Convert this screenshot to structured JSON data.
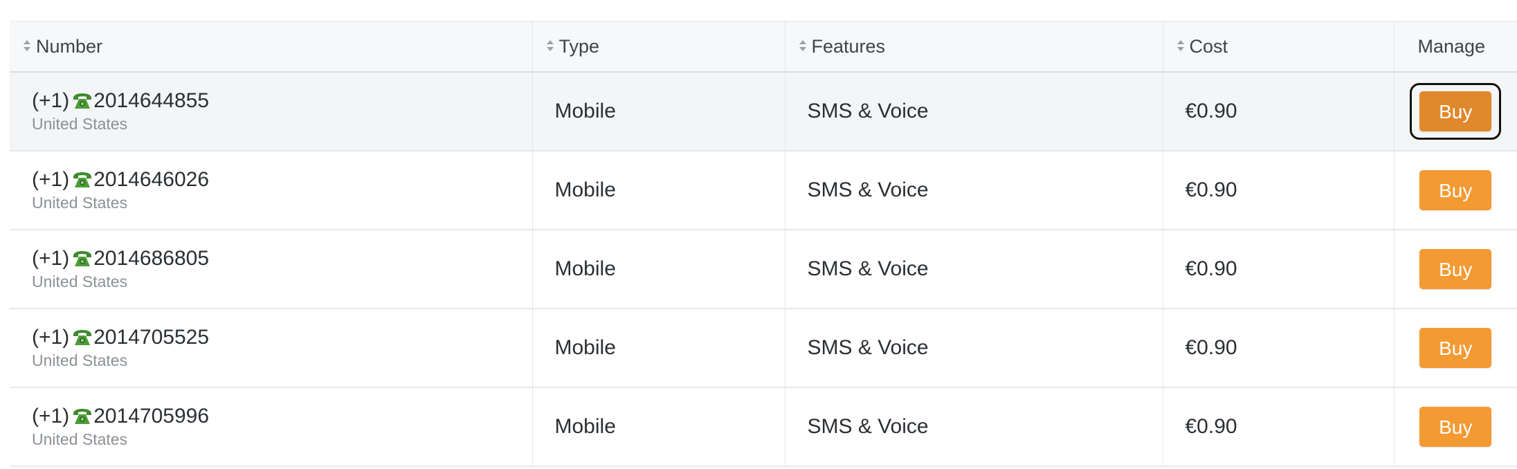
{
  "table": {
    "headers": {
      "number": "Number",
      "type": "Type",
      "features": "Features",
      "cost": "Cost",
      "manage": "Manage"
    },
    "rows": [
      {
        "prefix": "(+1)",
        "number": "2014644855",
        "country": "United States",
        "type": "Mobile",
        "features": "SMS & Voice",
        "cost": "€0.90",
        "action": "Buy"
      },
      {
        "prefix": "(+1)",
        "number": "2014646026",
        "country": "United States",
        "type": "Mobile",
        "features": "SMS & Voice",
        "cost": "€0.90",
        "action": "Buy"
      },
      {
        "prefix": "(+1)",
        "number": "2014686805",
        "country": "United States",
        "type": "Mobile",
        "features": "SMS & Voice",
        "cost": "€0.90",
        "action": "Buy"
      },
      {
        "prefix": "(+1)",
        "number": "2014705525",
        "country": "United States",
        "type": "Mobile",
        "features": "SMS & Voice",
        "cost": "€0.90",
        "action": "Buy"
      },
      {
        "prefix": "(+1)",
        "number": "2014705996",
        "country": "United States",
        "type": "Mobile",
        "features": "SMS & Voice",
        "cost": "€0.90",
        "action": "Buy"
      }
    ]
  },
  "icons": {
    "sort": "sort-icon",
    "phone": "telephone-icon"
  },
  "colors": {
    "buy_button": "#f49a33",
    "buy_button_active": "#e0882c",
    "phone_icon": "#3f8a2e"
  }
}
